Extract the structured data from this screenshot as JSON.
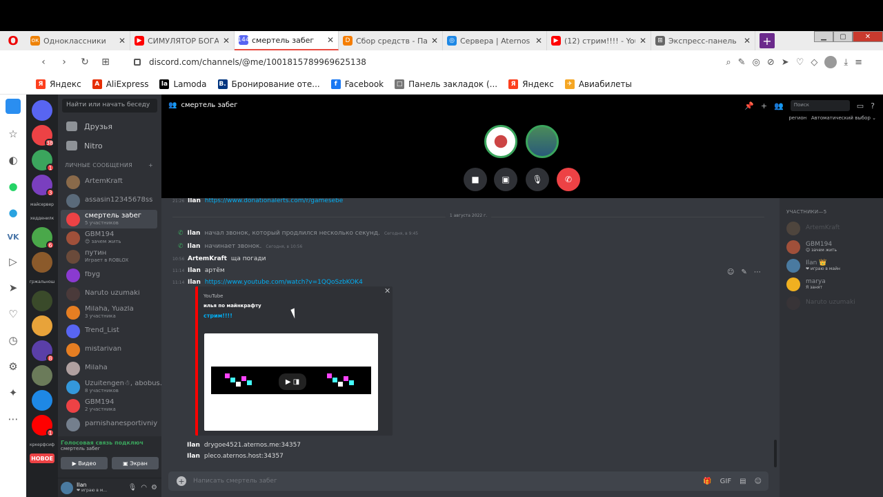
{
  "tabs": [
    {
      "label": "Одноклассники",
      "fav": "ок",
      "color": "#ee8208",
      "active": false
    },
    {
      "label": "СИМУЛЯТОР БОГА",
      "fav": "▶",
      "color": "#ff0000",
      "active": false
    },
    {
      "label": "смертель забег",
      "fav": "144",
      "color": "#5865f2",
      "active": true
    },
    {
      "label": "Сбор средств - Па",
      "fav": "D",
      "color": "#f57d00",
      "active": false
    },
    {
      "label": "Сервера | Aternos |",
      "fav": "◎",
      "color": "#1e88e5",
      "active": false
    },
    {
      "label": "(12) стрим!!!! - You",
      "fav": "▶",
      "color": "#ff0000",
      "active": false
    },
    {
      "label": "Экспресс-панель",
      "fav": "⊞",
      "color": "#666666",
      "active": false
    }
  ],
  "address": {
    "url": "discord.com/channels/@me/1001815789969625138"
  },
  "bookmarks": [
    {
      "label": "Яндекс",
      "fav": "Я",
      "color": "#fc3f1d"
    },
    {
      "label": "AliExpress",
      "fav": "A",
      "color": "#e62e04"
    },
    {
      "label": "Lamoda",
      "fav": "la",
      "color": "#000000"
    },
    {
      "label": "Бронирование оте...",
      "fav": "B.",
      "color": "#003580"
    },
    {
      "label": "Facebook",
      "fav": "f",
      "color": "#1877f2"
    },
    {
      "label": "Панель закладок (...",
      "fav": "□",
      "color": "#777777"
    },
    {
      "label": "Яндекс",
      "fav": "Я",
      "color": "#fc3f1d"
    },
    {
      "label": "Авиабилеты",
      "fav": "✈",
      "color": "#f5a623"
    }
  ],
  "guilds": [
    {
      "label": "",
      "color": "#5865f2",
      "badge": ""
    },
    {
      "label": "",
      "color": "#ed4245",
      "badge": "38"
    },
    {
      "label": "",
      "color": "#3ba55d",
      "badge": "1"
    },
    {
      "label": "",
      "color": "#7a3fbf",
      "badge": "3"
    },
    {
      "label": "майсервер",
      "txt": true
    },
    {
      "label": "хедденилк",
      "txt": true
    },
    {
      "label": "",
      "color": "#4aa84a",
      "badge": "6"
    },
    {
      "label": "",
      "color": "#8b5a2b",
      "badge": ""
    },
    {
      "label": "гржальнош",
      "txt": true
    },
    {
      "label": "",
      "color": "#3a4a2a",
      "badge": ""
    },
    {
      "label": "",
      "color": "#e8a33a",
      "badge": ""
    },
    {
      "label": "",
      "color": "#5a3fa8",
      "badge": "8"
    },
    {
      "label": "",
      "color": "#6b7b5a",
      "badge": ""
    },
    {
      "label": "",
      "color": "#1e88e5",
      "badge": ""
    },
    {
      "label": "",
      "color": "#ff0000",
      "badge": "1"
    },
    {
      "label": "кркерфсиф",
      "txt": true
    },
    {
      "label": "НОВОЕ",
      "new": true
    }
  ],
  "dm": {
    "search": "Найти или начать беседу",
    "friends": "Друзья",
    "nitro": "Nitro",
    "header": "ЛИЧНЫЕ СООБЩЕНИЯ",
    "plus": "+",
    "items": [
      {
        "name": "ArtemKraft",
        "sub": "",
        "color": "#8a6a4a",
        "sel": false
      },
      {
        "name": "assasin12345678ss",
        "sub": "",
        "color": "#5a6a7a",
        "sel": false
      },
      {
        "name": "смертель забег",
        "sub": "5 участников",
        "color": "#ed4245",
        "sel": true
      },
      {
        "name": "GBM194",
        "sub": "😊 зачем жить",
        "color": "#a0503a",
        "sel": false
      },
      {
        "name": "путин",
        "sub": "Играет в ROBLOX",
        "color": "#6a4a3a",
        "sel": false
      },
      {
        "name": "fbyg",
        "sub": "",
        "color": "#8a3ad0",
        "sel": false
      },
      {
        "name": "Naruto uzumaki",
        "sub": "",
        "color": "#4a3a3a",
        "sel": false
      },
      {
        "name": "Milaha, Yuazla",
        "sub": "3 участника",
        "color": "#e67e22",
        "sel": false
      },
      {
        "name": "Trend_List",
        "sub": "",
        "color": "#5865f2",
        "sel": false
      },
      {
        "name": "mistarivan",
        "sub": "",
        "color": "#e67e22",
        "sel": false
      },
      {
        "name": "Milaha",
        "sub": "",
        "color": "#b0a0a0",
        "sel": false
      },
      {
        "name": "Uzuitengen☃, abobus...",
        "sub": "8 участников",
        "color": "#3498db",
        "sel": false
      },
      {
        "name": "GBM194",
        "sub": "2 участника",
        "color": "#ed4245",
        "sel": false
      },
      {
        "name": "parnishanesportivniy",
        "sub": "",
        "color": "#747f8d",
        "sel": false
      }
    ],
    "voice_status": "Голосовая связь подключ",
    "voice_channel": "смертель забег",
    "video": "Видео",
    "screen": "Экран",
    "user_name": "Ilan",
    "user_status": "❤ играю в м..."
  },
  "channel": {
    "name": "смертель забег",
    "search": "Поиск",
    "region_label": "регион",
    "region_value": "Автоматический выбор"
  },
  "messages": {
    "top_link": "https://www.donationalerts.com/r/gamesebe",
    "top_ts": "21:26",
    "top_author": "Ilan",
    "date": "1 августа 2022 г.",
    "call1_author": "Ilan",
    "call1_text": "начал звонок, который продлился несколько секунд.",
    "call1_time": "Сегодня, в 9:45",
    "call2_author": "Ilan",
    "call2_text": "начинает звонок.",
    "call2_time": "Сегодня, в 10:56",
    "m1_ts": "10:56",
    "m1_author": "ArtemKraft",
    "m1_text": "ща погади",
    "m2_ts": "11:14",
    "m2_author": "Ilan",
    "m2_text": "артём",
    "m3_ts": "11:14",
    "m3_author": "Ilan",
    "m3_link": "https://www.youtube.com/watch?v=1QQoSzbKOK4",
    "embed_provider": "YouTube",
    "embed_author": "илья по майнкрафту",
    "embed_title": "стрим!!!!",
    "m4_author": "Ilan",
    "m4_text": "drygoe4521.aternos.me:34357",
    "m5_author": "Ilan",
    "m5_text": "pleco.aternos.host:34357",
    "input_placeholder": "Написать смертель забег"
  },
  "members": {
    "header": "УЧАСТНИКИ—5",
    "list": [
      {
        "name": "ArtemKraft",
        "status": "",
        "color": "#8a6a4a",
        "off": true
      },
      {
        "name": "GBM194",
        "status": "😊 зачем жить",
        "color": "#a0503a",
        "off": false
      },
      {
        "name": "Ilan 👑",
        "status": "❤ играю в майн",
        "color": "#4a7aa0",
        "off": false
      },
      {
        "name": "marya",
        "status": "Я занят",
        "color": "#f0b020",
        "off": false
      },
      {
        "name": "Naruto uzumaki",
        "status": "",
        "color": "#4a3a3a",
        "off": true
      }
    ]
  }
}
